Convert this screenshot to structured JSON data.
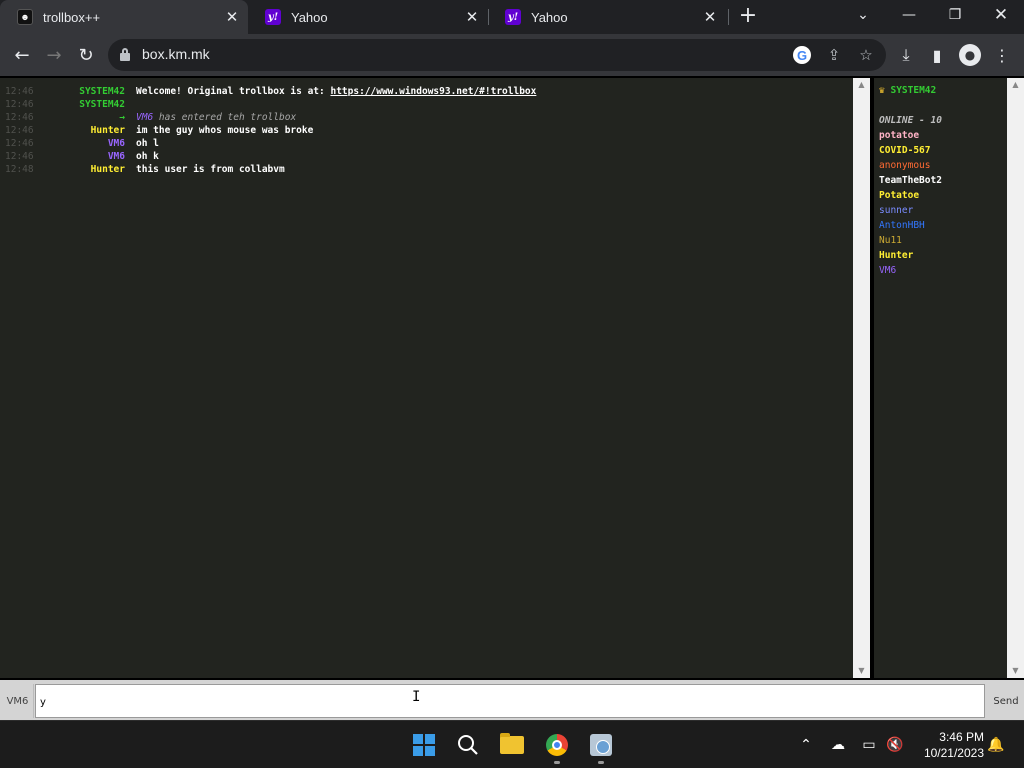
{
  "browser": {
    "tabs": [
      {
        "title": "trollbox++",
        "favicon": "trollbox-favicon-icon",
        "active": true
      },
      {
        "title": "Yahoo",
        "favicon": "yahoo-favicon-icon",
        "active": false
      },
      {
        "title": "Yahoo",
        "favicon": "yahoo-favicon-icon",
        "active": false
      }
    ],
    "url": "box.km.mk",
    "google_label": "G"
  },
  "chat": {
    "messages": [
      {
        "time": "12:46",
        "nick": "SYSTEM42",
        "nick_color": "#33cc33",
        "text": "Welcome! Original trollbox is at: ",
        "link": "https://www.windows93.net/#!trollbox"
      },
      {
        "time": "12:46",
        "nick": "SYSTEM42",
        "nick_color": "#33cc33",
        "text": ""
      },
      {
        "time": "12:46",
        "nick": "→",
        "nick_color": "#33cc33",
        "text_user": "VM6",
        "text_user_color": "#9966ff",
        "text": " has entered teh trollbox"
      },
      {
        "time": "12:46",
        "nick": "Hunter",
        "nick_color": "#ffee33",
        "text": "im the guy whos mouse was broke"
      },
      {
        "time": "12:46",
        "nick": "VM6",
        "nick_color": "#9966ff",
        "text": "oh l"
      },
      {
        "time": "12:46",
        "nick": "VM6",
        "nick_color": "#9966ff",
        "text": "oh k"
      },
      {
        "time": "12:48",
        "nick": "Hunter",
        "nick_color": "#ffee33",
        "text": "this user is from collabvm"
      }
    ]
  },
  "userlist": {
    "admin": {
      "crown": "♛",
      "name": "SYSTEM42",
      "color": "#33cc33"
    },
    "online_header": "ONLINE - 10",
    "users": [
      {
        "name": "potatoe",
        "color": "#ffb3c6"
      },
      {
        "name": "COVID-567",
        "color": "#ffee33"
      },
      {
        "name": "anonymous",
        "color": "#ff6a33"
      },
      {
        "name": "TeamTheBot2",
        "color": "#ffffff"
      },
      {
        "name": "Potatoe",
        "color": "#ffee33"
      },
      {
        "name": "sunner",
        "color": "#7a8cff"
      },
      {
        "name": "AntonHBH",
        "color": "#3377ff"
      },
      {
        "name": "Nu11",
        "color": "#ccaa33"
      },
      {
        "name": "Hunter",
        "color": "#ffee33"
      },
      {
        "name": "VM6",
        "color": "#9966ff"
      }
    ]
  },
  "composer": {
    "nick": "VM6",
    "value": "y",
    "send_label": "Send"
  },
  "taskbar": {
    "time": "3:46 PM",
    "date": "10/21/2023"
  }
}
